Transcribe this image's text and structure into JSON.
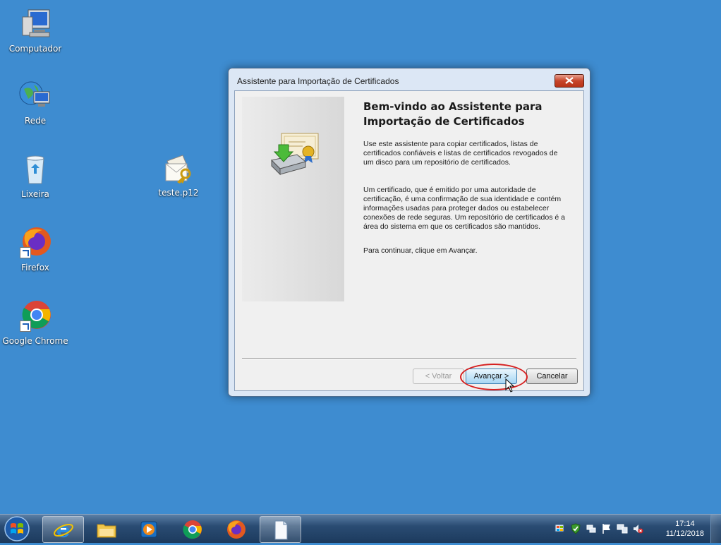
{
  "desktop": {
    "icons": [
      {
        "label": "Computador"
      },
      {
        "label": "Rede"
      },
      {
        "label": "Lixeira"
      },
      {
        "label": "teste.p12"
      },
      {
        "label": "Firefox"
      },
      {
        "label": "Google Chrome"
      }
    ]
  },
  "dialog": {
    "title": "Assistente para Importação de Certificados",
    "headline": "Bem-vindo ao Assistente para Importação de Certificados",
    "paragraph1": "Use este assistente para copiar certificados, listas de certificados confiáveis e listas de certificados revogados de um disco para um repositório de certificados.",
    "paragraph2": "Um certificado, que é emitido por uma autoridade de certificação, é uma confirmação de sua identidade e contém informações usadas para proteger dados ou estabelecer conexões de rede seguras. Um repositório de certificados é a área do sistema em que os certificados são mantidos.",
    "paragraph3": "Para continuar, clique em Avançar.",
    "buttons": {
      "back": "< Voltar",
      "next": "Avançar >",
      "cancel": "Cancelar"
    }
  },
  "taskbar": {
    "apps": [
      "internet-explorer",
      "windows-explorer",
      "media-player",
      "google-chrome",
      "firefox",
      "notepad"
    ],
    "clock": {
      "time": "17:14",
      "date": "11/12/2018"
    }
  },
  "colors": {
    "desktop_bg": "#3e8cd0",
    "highlight": "#d62020"
  }
}
